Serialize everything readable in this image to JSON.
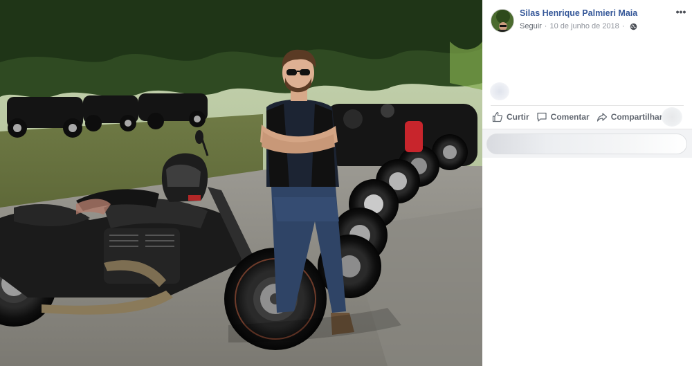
{
  "post": {
    "author_name": "Silas Henrique Palmieri Maia",
    "follow_label": "Seguir",
    "separator": "·",
    "date": "10 de junho de 2018",
    "separator2": "·",
    "privacy_icon": "globe-icon",
    "more_options_icon": "more-options-icon",
    "more_options_label": "•••"
  },
  "actions": {
    "like_label": "Curtir",
    "comment_label": "Comentar",
    "share_label": "Compartilhar"
  },
  "photo": {
    "subject": "man in sunglasses standing in front of a row of parked motorcycles"
  },
  "colors": {
    "link_blue": "#365899",
    "meta_gray": "#90949c",
    "action_gray": "#616770",
    "divider": "#e5e5e5",
    "comment_bg": "#f2f3f5"
  }
}
